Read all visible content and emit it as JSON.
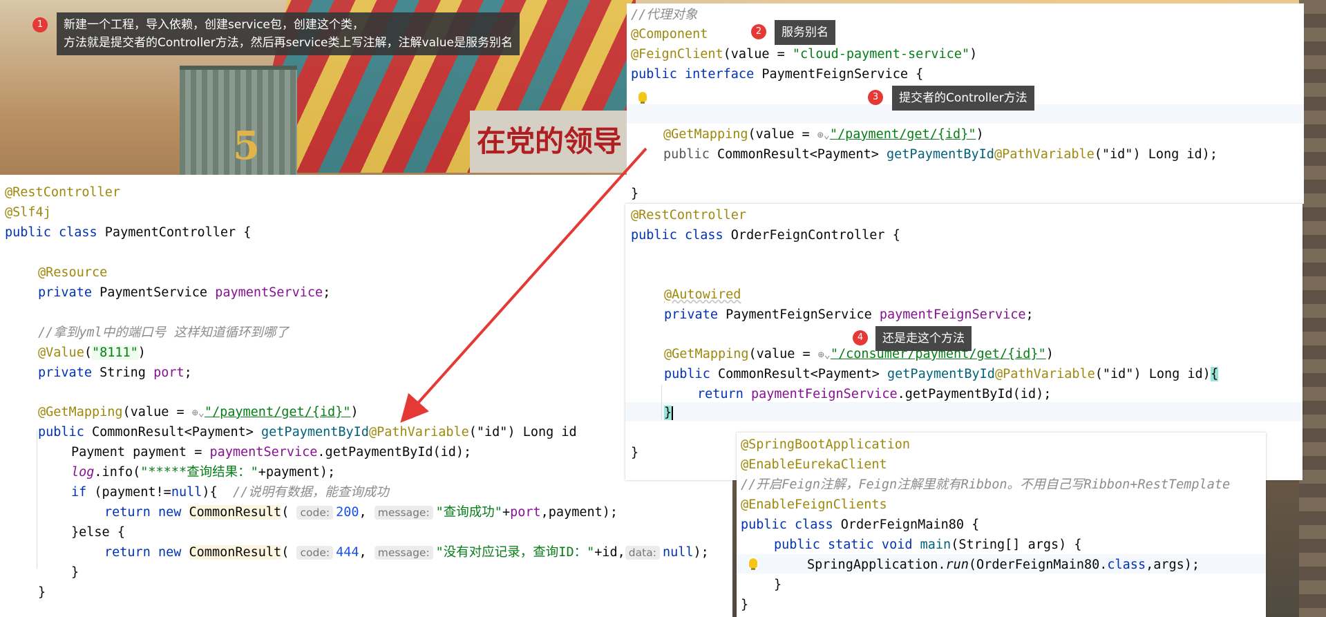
{
  "annotations": {
    "note1": {
      "badge": "1",
      "text": "新建一个工程，导入依赖，创建service包，创建这个类，\n方法就是提交者的Controller方法，然后再service类上写注解，注解value是服务别名"
    },
    "note2": {
      "badge": "2",
      "text": "服务别名"
    },
    "note3": {
      "badge": "3",
      "text": "提交者的Controller方法"
    },
    "note4": {
      "badge": "4",
      "text": "还是走这个方法"
    }
  },
  "scene": {
    "sign_text": "在党的领导",
    "tower_number": "5"
  },
  "feign_service": {
    "comment": "//代理对象",
    "component": "@Component",
    "feign_client": "@FeignClient",
    "value_kw": "(value = ",
    "value_str": "\"cloud-payment-service\"",
    "close_paren": ")",
    "public": "public",
    "interface": "interface",
    "name": "PaymentFeignService {",
    "get_mapping": "@GetMapping",
    "gm_value": "(value = ",
    "path": "\"/payment/get/{id}\"",
    "gm_close": ")",
    "method_public": "public",
    "method_type": "CommonResult<Payment>",
    "method_name": "getPaymentById",
    "path_var": "@PathVariable",
    "pv_arg": "(\"id\") Long id);",
    "close_brace": "}"
  },
  "payment_controller": {
    "rest_controller": "@RestController",
    "slf4j": "@Slf4j",
    "class_decl_kw": "public class",
    "class_name": "PaymentController {",
    "resource": "@Resource",
    "private1": "private",
    "service_type": "PaymentService",
    "service_field": "paymentService",
    "semi": ";",
    "comment_port": "//拿到yml中的端口号 这样知道循环到哪了",
    "value_ann": "@Value",
    "value_arg_open": "(",
    "value_arg": "\"8111\"",
    "value_arg_close": ")",
    "private2": "private",
    "port_type": "String",
    "port_field": "port",
    "get_mapping": "@GetMapping",
    "gm_value": "(value = ",
    "path": "\"/payment/get/{id}\"",
    "gm_close": ")",
    "method_public": "public",
    "method_type": "CommonResult<Payment>",
    "method_name": "getPaymentById",
    "path_var": "@PathVariable",
    "pv_arg": "(\"id\") Long id",
    "line_payment": "Payment payment = ",
    "line_payment_svc": "paymentService",
    "line_payment_call": ".getPaymentById(id);",
    "log": "log",
    "log_info": ".info(",
    "log_str": "\"*****查询结果：\"",
    "log_rest": "+payment);",
    "if_kw": "if",
    "if_cond": " (payment!=",
    "null1": "null",
    "if_close": "){  ",
    "if_comment": "//说明有数据，能查询成功",
    "return1": "return",
    "new1": "new",
    "cr1": "CommonResult",
    "hint_code": "code:",
    "code200": "200",
    "hint_message": "message:",
    "msg_success": "\"查询成功\"",
    "msg_success_rest1": "+",
    "msg_success_port": "port",
    "msg_success_rest2": ",payment);",
    "else_line": "}else {",
    "return2": "return",
    "new2": "new",
    "cr2": "CommonResult",
    "code444": "444",
    "msg_fail": "\"没有对应记录，查询ID：\"",
    "msg_fail_rest": "+id,",
    "hint_data": "data:",
    "null2": "null",
    "close_call": ");",
    "brace1": "}",
    "brace2": "}"
  },
  "order_controller": {
    "rest_controller": "@RestController",
    "class_decl_kw": "public class",
    "class_name": "OrderFeignController {",
    "autowired": "@Autowired",
    "private": "private",
    "svc_type": "PaymentFeignService",
    "svc_field": "paymentFeignService",
    "semi": ";",
    "get_mapping": "@GetMapping",
    "gm_value": "(value = ",
    "path": "\"/consumer/payment/get/{id}\"",
    "gm_close": ")",
    "method_public": "public",
    "method_type": "CommonResult<Payment>",
    "method_name": "getPaymentById",
    "path_var": "@PathVariable",
    "pv_arg": "(\"id\") Long id)",
    "open_brace": "{",
    "return_kw": "return",
    "return_field": "paymentFeignService",
    "return_call": ".getPaymentById(id);",
    "close_method": "}",
    "close_class": "}"
  },
  "main_class": {
    "sba": "@SpringBootApplication",
    "eureka": "@EnableEurekaClient",
    "comment": "//开启Feign注解，Feign注解里就有Ribbon。不用自己写Ribbon+RestTemplate",
    "feign": "@EnableFeignClients",
    "class_decl_kw": "public class",
    "class_name": "OrderFeignMain80 {",
    "main_sig_kw": "public static void",
    "main_name": "main",
    "main_args": "(String[] args) {",
    "spring_app": "SpringApplication.",
    "run": "run",
    "run_arg": "(OrderFeignMain80.",
    "class_kw": "class",
    "run_rest": ",args);",
    "brace1": "}",
    "brace2": "}"
  },
  "colors": {
    "annotation": "#9e880d",
    "keyword": "#0033b3",
    "string": "#067d17",
    "field": "#871094",
    "badge": "#e53935",
    "arrow": "#e53935"
  }
}
